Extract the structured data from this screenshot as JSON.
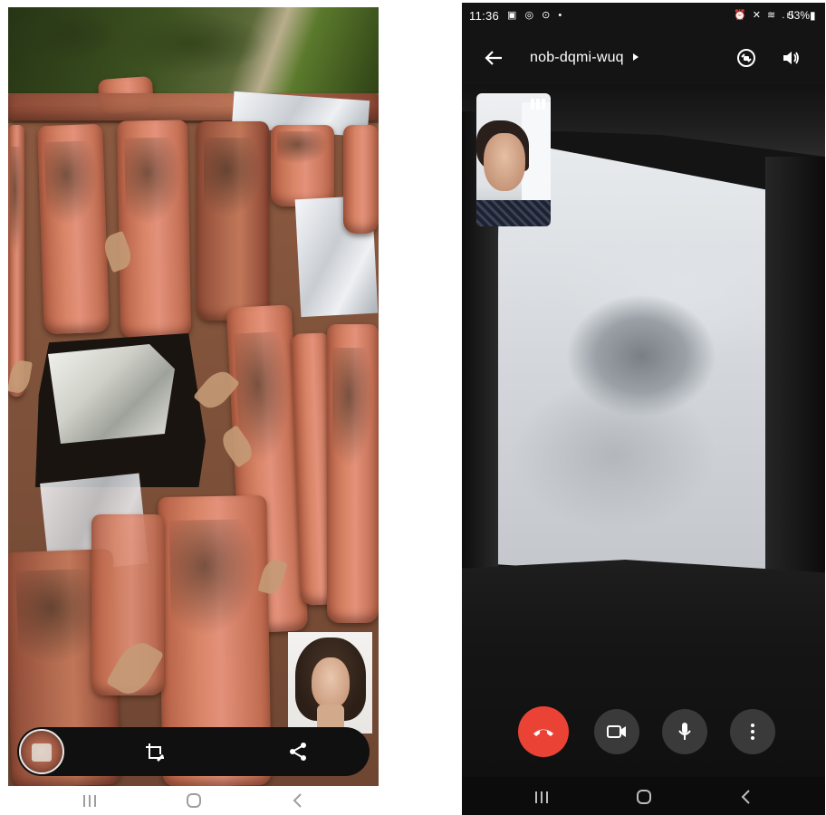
{
  "left_phone": {
    "screen": "camera-capture",
    "toolbar": {
      "thumbnail_icon": "photo-thumbnail",
      "crop_icon": "crop-rotate-icon",
      "share_icon": "share-icon"
    },
    "navigation": [
      "recent-apps-icon",
      "home-icon",
      "back-icon"
    ]
  },
  "right_phone": {
    "status_bar": {
      "time": "11:36",
      "left_icons": "▣ ◎ ⊙ •",
      "right_icons": "⏰ ✕ ≋ .ıl",
      "battery": "53%▮"
    },
    "call": {
      "meeting_code": "nob-dqmi-wuq",
      "back_icon": "arrow-left-icon",
      "switch_camera_icon": "camera-switch-icon",
      "speaker_icon": "speaker-icon"
    },
    "controls": [
      {
        "name": "end-call",
        "icon": "phone-hangup-icon",
        "color": "#ea4335"
      },
      {
        "name": "camera",
        "icon": "video-camera-icon",
        "color": "#3a3a3a"
      },
      {
        "name": "microphone",
        "icon": "microphone-icon",
        "color": "#3a3a3a"
      },
      {
        "name": "more-options",
        "icon": "more-vertical-icon",
        "color": "#3a3a3a"
      }
    ],
    "navigation": [
      "recent-apps-icon",
      "home-icon",
      "back-icon"
    ]
  }
}
